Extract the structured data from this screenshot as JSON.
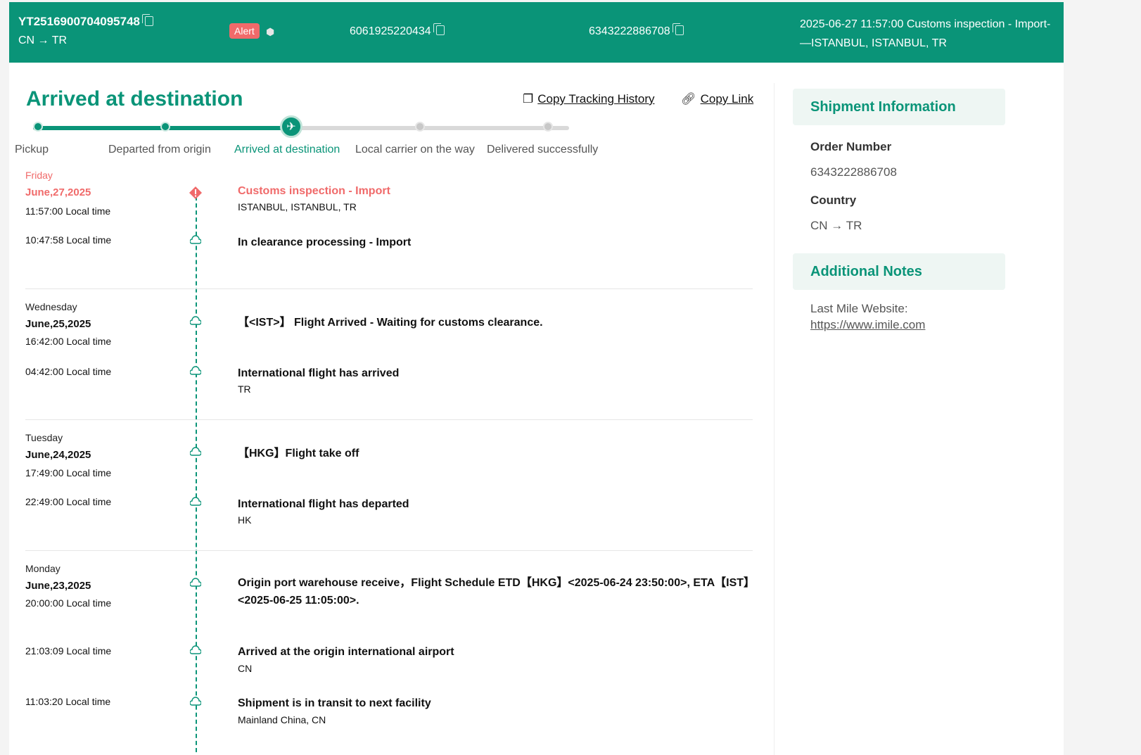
{
  "header": {
    "tracking_number": "YT2516900704095748",
    "route": "CN → TR",
    "alert_label": "Alert",
    "box_icon": "package-icon",
    "id1": "6061925220434",
    "id2": "6343222886708",
    "latest_status": "2025-06-27 11:57:00 Customs inspection - Import-—ISTANBUL, ISTANBUL, TR",
    "bg_color": "#0a9478",
    "alert_color": "#f06a6a"
  },
  "status_title": "Arrived at destination",
  "actions": {
    "copy_history": "Copy Tracking History",
    "copy_link": "Copy Link"
  },
  "progress": {
    "steps": [
      "Pickup",
      "Departed from origin",
      "Arrived at destination",
      "Local carrier on the way",
      "Delivered successfully"
    ],
    "current_index": 2
  },
  "timeline": [
    {
      "weekday": "Friday",
      "date": "June,27,2025",
      "events": [
        {
          "time": "11:57:00 Local time",
          "title": "Customs inspection - Import",
          "location": "ISTANBUL, ISTANBUL, TR",
          "alert": true
        },
        {
          "time": "10:47:58 Local time",
          "title": "In clearance processing - Import",
          "location": ""
        }
      ]
    },
    {
      "weekday": "Wednesday",
      "date": "June,25,2025",
      "events": [
        {
          "time": "16:42:00 Local time",
          "title": "【<IST>】 Flight Arrived - Waiting for customs clearance.",
          "location": ""
        },
        {
          "time": "04:42:00 Local time",
          "title": "International flight has arrived",
          "location": "TR"
        }
      ]
    },
    {
      "weekday": "Tuesday",
      "date": "June,24,2025",
      "events": [
        {
          "time": "17:49:00 Local time",
          "title": "【HKG】Flight take off",
          "location": ""
        },
        {
          "time": "22:49:00 Local time",
          "title": "International flight has departed",
          "location": "HK"
        }
      ]
    },
    {
      "weekday": "Monday",
      "date": "June,23,2025",
      "events": [
        {
          "time": "20:00:00 Local time",
          "title": "Origin port warehouse receive，Flight Schedule ETD【HKG】<2025-06-24 23:50:00>, ETA【IST】<2025-06-25 11:05:00>.",
          "location": ""
        },
        {
          "time": "21:03:09 Local time",
          "title": "Arrived at the origin international airport",
          "location": "CN"
        },
        {
          "time": "11:03:20 Local time",
          "title": "Shipment is in transit to next facility",
          "location": "Mainland China, CN"
        }
      ]
    }
  ],
  "shipment_info": {
    "heading": "Shipment Information",
    "order_label": "Order Number",
    "order_value": "6343222886708",
    "country_label": "Country",
    "country_value": "CN → TR"
  },
  "additional_notes": {
    "heading": "Additional Notes",
    "last_mile_label": "Last Mile Website:",
    "last_mile_url": "https://www.imile.com"
  }
}
